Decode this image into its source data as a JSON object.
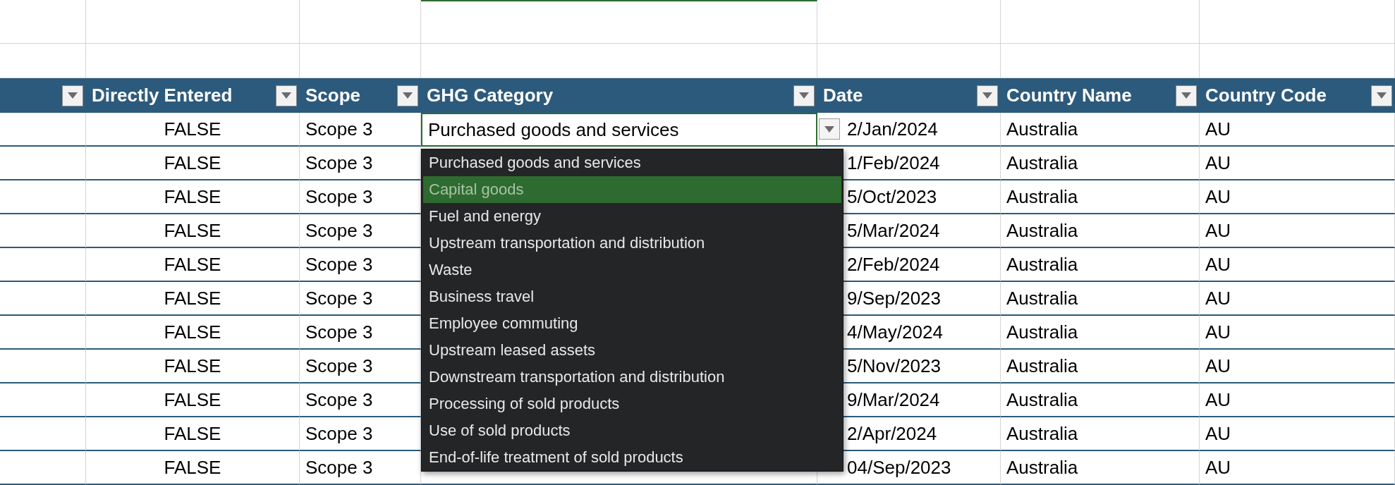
{
  "table": {
    "columns": [
      {},
      {
        "label": "Directly Entered"
      },
      {
        "label": "Scope"
      },
      {
        "label": "GHG Category"
      },
      {
        "label": "Date"
      },
      {
        "label": "Country Name"
      },
      {
        "label": "Country Code"
      }
    ],
    "rows": [
      {
        "directly_entered": "FALSE",
        "scope": "Scope 3",
        "ghg_category": "Purchased goods and services",
        "editing": true,
        "date": "2/Jan/2024",
        "country_name": "Australia",
        "country_code": "AU"
      },
      {
        "directly_entered": "FALSE",
        "scope": "Scope 3",
        "editing": false,
        "date": "1/Feb/2024",
        "country_name": "Australia",
        "country_code": "AU"
      },
      {
        "directly_entered": "FALSE",
        "scope": "Scope 3",
        "editing": false,
        "date": "5/Oct/2023",
        "country_name": "Australia",
        "country_code": "AU"
      },
      {
        "directly_entered": "FALSE",
        "scope": "Scope 3",
        "editing": false,
        "date": "5/Mar/2024",
        "country_name": "Australia",
        "country_code": "AU"
      },
      {
        "directly_entered": "FALSE",
        "scope": "Scope 3",
        "editing": false,
        "date": "2/Feb/2024",
        "country_name": "Australia",
        "country_code": "AU"
      },
      {
        "directly_entered": "FALSE",
        "scope": "Scope 3",
        "editing": false,
        "date": "9/Sep/2023",
        "country_name": "Australia",
        "country_code": "AU"
      },
      {
        "directly_entered": "FALSE",
        "scope": "Scope 3",
        "editing": false,
        "date": "4/May/2024",
        "country_name": "Australia",
        "country_code": "AU"
      },
      {
        "directly_entered": "FALSE",
        "scope": "Scope 3",
        "editing": false,
        "date": "5/Nov/2023",
        "country_name": "Australia",
        "country_code": "AU"
      },
      {
        "directly_entered": "FALSE",
        "scope": "Scope 3",
        "editing": false,
        "date": "9/Mar/2024",
        "country_name": "Australia",
        "country_code": "AU"
      },
      {
        "directly_entered": "FALSE",
        "scope": "Scope 3",
        "editing": false,
        "date": "2/Apr/2024",
        "country_name": "Australia",
        "country_code": "AU"
      },
      {
        "directly_entered": "FALSE",
        "scope": "Scope 3",
        "editing": false,
        "date": "04/Sep/2023",
        "country_name": "Australia",
        "country_code": "AU"
      }
    ]
  },
  "dropdown": {
    "options": [
      {
        "label": "Purchased goods and services",
        "selected": false
      },
      {
        "label": "Capital goods",
        "selected": true
      },
      {
        "label": "Fuel and energy",
        "selected": false
      },
      {
        "label": "Upstream transportation and distribution",
        "selected": false
      },
      {
        "label": "Waste",
        "selected": false
      },
      {
        "label": "Business travel",
        "selected": false
      },
      {
        "label": "Employee commuting",
        "selected": false
      },
      {
        "label": "Upstream leased assets",
        "selected": false
      },
      {
        "label": "Downstream transportation and distribution",
        "selected": false
      },
      {
        "label": "Processing of sold products",
        "selected": false
      },
      {
        "label": "Use of sold products",
        "selected": false
      },
      {
        "label": "End-of-life treatment of sold products",
        "selected": false
      }
    ]
  }
}
